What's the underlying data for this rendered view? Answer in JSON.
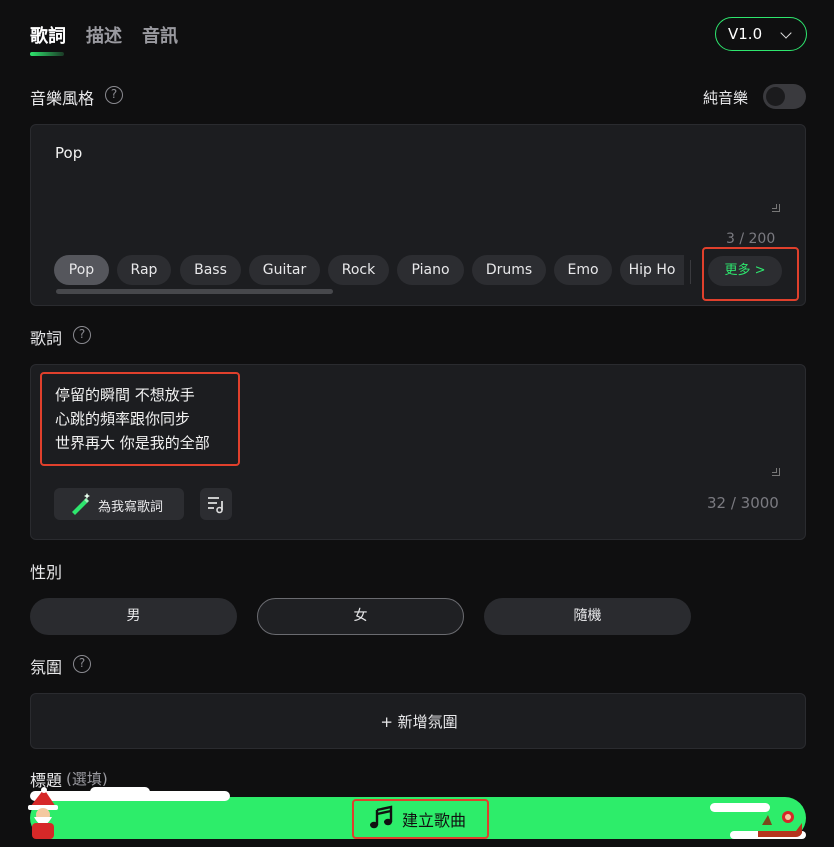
{
  "tabs": [
    "歌詞",
    "描述",
    "音訊"
  ],
  "version": "V1.0",
  "style_section": {
    "label": "音樂風格",
    "instrumental_label": "純音樂",
    "value": "Pop",
    "counter": "3 / 200",
    "chips": [
      "Pop",
      "Rap",
      "Bass",
      "Guitar",
      "Rock",
      "Piano",
      "Drums",
      "Emo",
      "Hip Ho"
    ],
    "more": "更多 >"
  },
  "lyrics_section": {
    "label": "歌詞",
    "lines": [
      "停留的瞬間 不想放手",
      "心跳的頻率跟你同步",
      "世界再大 你是我的全部"
    ],
    "write_button": "為我寫歌詞",
    "counter": "32 / 3000"
  },
  "gender_section": {
    "label": "性別",
    "options": [
      "男",
      "女",
      "隨機"
    ]
  },
  "mood_section": {
    "label": "氛圍",
    "add_button": "+ 新增氛圍"
  },
  "title_section": {
    "label": "標題",
    "hint": "(選填)"
  },
  "create_button": "建立歌曲",
  "colors": {
    "accent": "#2ee66e",
    "highlight_box": "#e0402c"
  }
}
